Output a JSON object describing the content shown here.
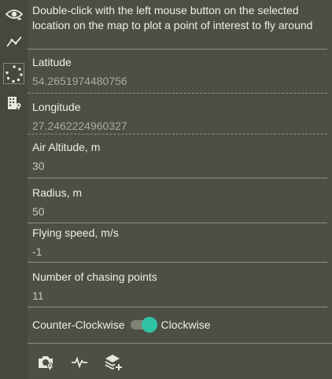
{
  "sidebar": {
    "items": [
      {
        "icon": "eye-icon"
      },
      {
        "icon": "route-icon"
      },
      {
        "icon": "orbit-icon",
        "active": true
      },
      {
        "icon": "building-icon"
      }
    ]
  },
  "panel": {
    "hint": "Double-click with the left mouse button on the selected location on the map to plot a point of interest to fly around",
    "latitude": {
      "label": "Latitude",
      "value": "54.2651974480756"
    },
    "longitude": {
      "label": "Longitude",
      "value": "27.2462224960327"
    },
    "altitude": {
      "label": "Air Altitude, m",
      "value": "30"
    },
    "radius": {
      "label": "Radius, m",
      "value": "50"
    },
    "speed": {
      "label": "Flying speed, m/s",
      "value": "-1"
    },
    "chasing": {
      "label": "Number of chasing points",
      "value": "11"
    },
    "direction": {
      "left_label": "Counter-Clockwise",
      "right_label": "Clockwise",
      "clockwise": true
    }
  },
  "footer": {
    "buttons": [
      {
        "icon": "camera-location-icon"
      },
      {
        "icon": "pulse-icon"
      },
      {
        "icon": "add-layer-icon"
      }
    ]
  },
  "colors": {
    "accent": "#2fc3a3",
    "background": "#4d4f46"
  }
}
